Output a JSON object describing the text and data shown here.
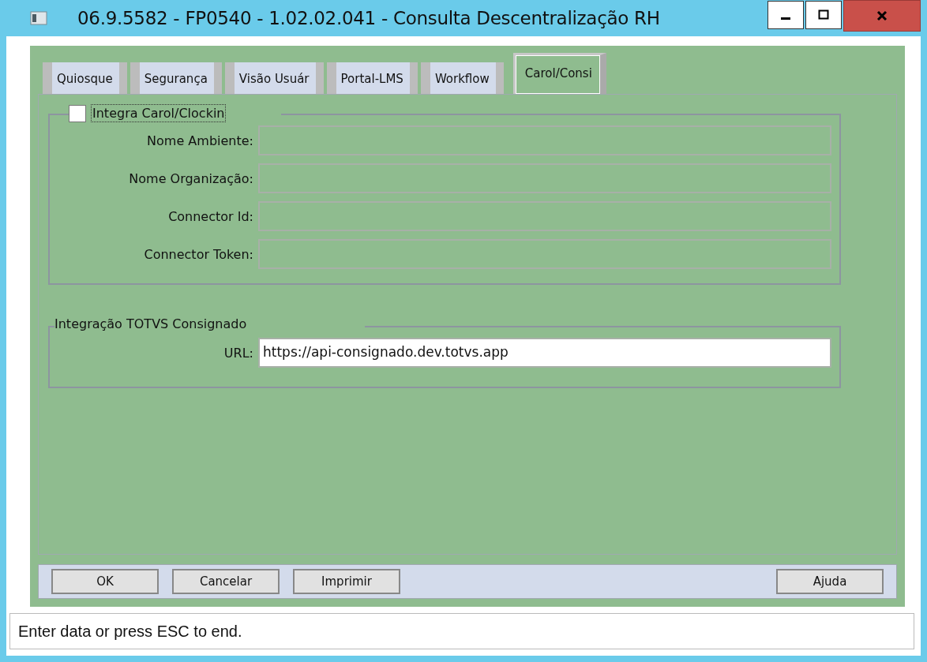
{
  "window": {
    "title": "06.9.5582 - FP0540 - 1.02.02.041 - Consulta Descentralização RH"
  },
  "tabs": [
    {
      "label": "Quiosque",
      "selected": false
    },
    {
      "label": "Segurança",
      "selected": false
    },
    {
      "label": "Visão Usuár",
      "selected": false
    },
    {
      "label": "Portal-LMS",
      "selected": false
    },
    {
      "label": "Workflow",
      "selected": false
    },
    {
      "label": "Carol/Consi",
      "selected": true
    }
  ],
  "carol_group": {
    "checkbox": {
      "label": "Integra Carol/Clockin",
      "checked": false
    },
    "fields": [
      {
        "label": "Nome Ambiente:"
      },
      {
        "label": "Nome Organização:"
      },
      {
        "label": "Connector Id:"
      },
      {
        "label": "Connector Token:"
      }
    ]
  },
  "consignado_group": {
    "title": "Integração TOTVS Consignado",
    "fields": [
      {
        "label": "URL:",
        "value": "https://api-consignado.dev.totvs.app"
      }
    ]
  },
  "buttons_left": [
    {
      "label": "OK"
    },
    {
      "label": "Cancelar"
    },
    {
      "label": "Imprimir"
    }
  ],
  "buttons_right": [
    {
      "label": "Ajuda"
    }
  ],
  "status_bar": "Enter data or press ESC to end."
}
